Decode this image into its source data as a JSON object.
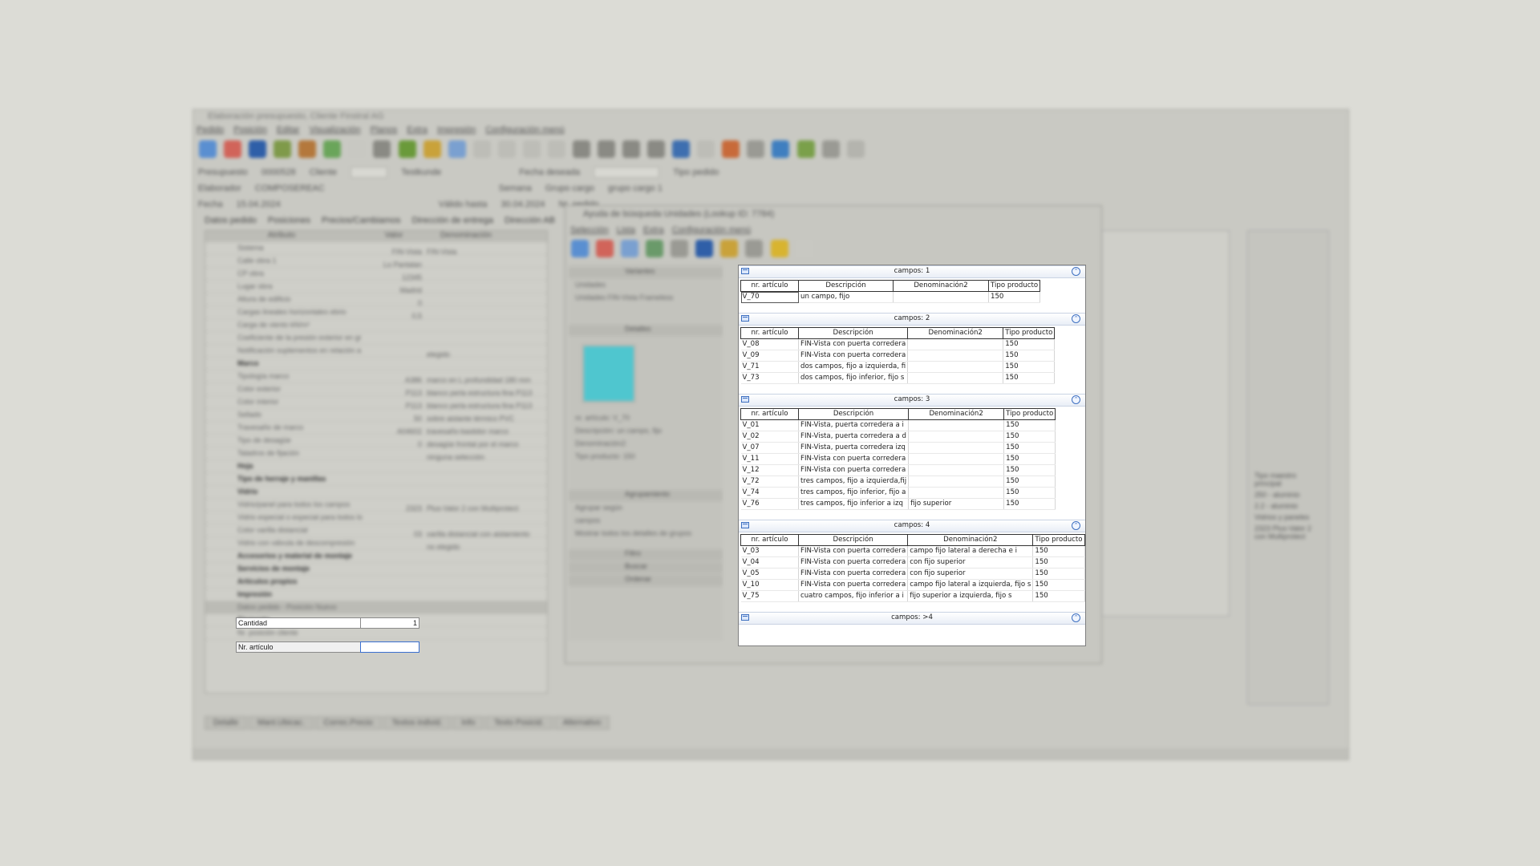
{
  "main_window": {
    "title": "Elaboración presupuesto, Cliente Finstral AG",
    "menu": [
      "Pedido",
      "Posición",
      "Editar",
      "Visualización",
      "Planos",
      "Extra",
      "Impresión",
      "Configuración menú"
    ],
    "form": {
      "presupuesto_label": "Presupuesto",
      "presupuesto_value": "0000528",
      "cliente_label": "Cliente",
      "cliente_value": "Testkunde",
      "fecha_deseada_label": "Fecha deseada",
      "tipo_pedido_label": "Tipo pedido",
      "elaborador_label": "Elaborador",
      "elaborador_value": "COMPOSEREAC",
      "semana_label": "Semana",
      "grupo_cargo_label": "Grupo cargo",
      "grupo_cargo_value": "grupo cargo 1",
      "fecha_label": "Fecha",
      "fecha_value": "15.04.2024",
      "valido_hasta_label": "Válido hasta",
      "valido_hasta_value": "30.04.2024",
      "nr_pedido_label": "Nr. pedido"
    },
    "tabs": [
      "Datos pedido",
      "Posiciones",
      "Precios/Cambiamos",
      "Dirección de entrega",
      "Dirección AB"
    ],
    "grid_headers": [
      "Atributo",
      "Valor",
      "Denominación"
    ],
    "grid_rows": [
      {
        "label": "Sistema",
        "value": "FIN-Vista",
        "desc": "FIN-Vista",
        "kind": "row"
      },
      {
        "label": "Calle obra 1",
        "value": "Lo Pantalan",
        "desc": "",
        "kind": "row"
      },
      {
        "label": "CP obra",
        "value": "12345",
        "desc": "",
        "kind": "row"
      },
      {
        "label": "Lugar obra",
        "value": "Madrid",
        "desc": "",
        "kind": "row"
      },
      {
        "label": "Altura de edificio",
        "value": "0",
        "desc": "",
        "kind": "row"
      },
      {
        "label": "Cargas lineales horizontales ebrio",
        "value": "0,5",
        "desc": "",
        "kind": "row"
      },
      {
        "label": "Carga de viento kN/m²",
        "value": "",
        "desc": "",
        "kind": "row"
      },
      {
        "label": "Coeficiente de la presión exterior en gr",
        "value": "",
        "desc": "",
        "kind": "row"
      },
      {
        "label": "Notificación suplementos en relación a",
        "value": "",
        "desc": "elegido",
        "kind": "row"
      },
      {
        "label": "Marco",
        "value": "",
        "desc": "",
        "kind": "bold"
      },
      {
        "label": "Tipología marco",
        "value": "A386",
        "desc": "marco en L profundidad 180 mm",
        "kind": "row"
      },
      {
        "label": "Color exterior",
        "value": "P113",
        "desc": "blanco perla estructura fina P113",
        "kind": "row"
      },
      {
        "label": "Color interior",
        "value": "P113",
        "desc": "blanco perla estructura fina P113",
        "kind": "row"
      },
      {
        "label": "Sellado",
        "value": "50",
        "desc": "sobre aislante térmico PVC",
        "kind": "row"
      },
      {
        "label": "Travesaño de marco",
        "value": "A04602",
        "desc": "travesaño-bastidor marco",
        "kind": "row"
      },
      {
        "label": "Tipo de desagüe",
        "value": "0",
        "desc": "desagüe frontal por el marco",
        "kind": "row"
      },
      {
        "label": "Taladros de fijación",
        "value": "",
        "desc": "ninguna selección",
        "kind": "row"
      },
      {
        "label": "Hoja",
        "value": "",
        "desc": "",
        "kind": "bold"
      },
      {
        "label": "Tipo de herraje y manillas",
        "value": "",
        "desc": "",
        "kind": "bold"
      },
      {
        "label": "Vidrio",
        "value": "",
        "desc": "",
        "kind": "bold"
      },
      {
        "label": "Vidrio/panel para todos los campos",
        "value": "2323",
        "desc": "Plus-Valor 2 con Multiprotect",
        "kind": "row"
      },
      {
        "label": "Vidrio especial o especial para todos lo",
        "value": "",
        "desc": "",
        "kind": "row"
      },
      {
        "label": "Color varilla distancial",
        "value": "03",
        "desc": "varilla distancial con aislamiento",
        "kind": "row"
      },
      {
        "label": "Vidrio con válvula de descompresión",
        "value": "",
        "desc": "no elegido",
        "kind": "row"
      },
      {
        "label": "Accesorios y material de montaje",
        "value": "",
        "desc": "",
        "kind": "bold"
      },
      {
        "label": "Servicios de montaje",
        "value": "",
        "desc": "",
        "kind": "bold"
      },
      {
        "label": "Artículos propios",
        "value": "",
        "desc": "",
        "kind": "bold"
      },
      {
        "label": "Impresión",
        "value": "",
        "desc": "",
        "kind": "bold"
      },
      {
        "label": "Datos pedido - Posición Nuevo",
        "value": "",
        "desc": "",
        "kind": "sec"
      },
      {
        "label": "Elemento",
        "value": "",
        "desc": "",
        "kind": "bold"
      },
      {
        "label": "Nr. posición cliente",
        "value": "",
        "desc": "",
        "kind": "row"
      }
    ],
    "cantidad_label": "Cantidad",
    "cantidad_value": "1",
    "nr_articulo_label": "Nr. artículo",
    "nr_articulo_value": "",
    "bottom_buttons": [
      "Detalle",
      "Mant.Ubicac.",
      "Correc.Precio",
      "Textos individ.",
      "Info",
      "Texto Posicid.",
      "Alternativo"
    ],
    "right_tree": [
      "Tipo maestro principal",
      "250 - aluminio",
      "2.2 - aluminio",
      "Vidrios y paneles",
      "2323 Plus-Valor 2 con Multiprotect"
    ]
  },
  "dialog": {
    "title": "Ayuda de búsqueda Unidades (Lookup ID: 7784)",
    "menu": [
      "Selección",
      "Lista",
      "Extra",
      "Configuración menú"
    ],
    "left": {
      "variantes_label": "Variantes",
      "option1": "Unidades",
      "option2": "Unidades FIN-Vista Frameless",
      "detalles_label": "Detalles",
      "detail_lines": [
        "nr. artículo: V_70",
        "Descripción: un campo, fijo",
        "Denominación2:",
        "Tipo producto: 150"
      ],
      "agrupamiento_label": "Agrupamiento",
      "agrupar_label": "Agrupar según",
      "agrupar_value": "campos",
      "mostrar_label": "Mostrar todos los detalles de grupos",
      "filtro_label": "Filtro",
      "buscar_label": "Buscar",
      "ordenar_label": "Ordenar"
    },
    "swatch_color": "#4fc6cf"
  },
  "results": {
    "columns": [
      "nr. artículo",
      "Descripción",
      "Denominación2",
      "Tipo producto"
    ],
    "groups": [
      {
        "title": "campos: 1",
        "rows": [
          [
            "V_70",
            "un campo, fijo",
            "",
            "150"
          ]
        ]
      },
      {
        "title": "campos: 2",
        "rows": [
          [
            "V_08",
            "FIN-Vista con puerta corredera",
            "",
            "150"
          ],
          [
            "V_09",
            "FIN-Vista con puerta corredera",
            "",
            "150"
          ],
          [
            "V_71",
            "dos campos, fijo a izquierda, fi",
            "",
            "150"
          ],
          [
            "V_73",
            "dos campos, fijo inferior, fijo s",
            "",
            "150"
          ]
        ]
      },
      {
        "title": "campos: 3",
        "rows": [
          [
            "V_01",
            "FIN-Vista, puerta corredera a i",
            "",
            "150"
          ],
          [
            "V_02",
            "FIN-Vista, puerta corredera a d",
            "",
            "150"
          ],
          [
            "V_07",
            "FIN-Vista, puerta corredera izq",
            "",
            "150"
          ],
          [
            "V_11",
            "FIN-Vista con puerta corredera",
            "",
            "150"
          ],
          [
            "V_12",
            "FIN-Vista con puerta corredera",
            "",
            "150"
          ],
          [
            "V_72",
            "tres campos, fijo a izquierda,fij",
            "",
            "150"
          ],
          [
            "V_74",
            "tres campos, fijo inferior, fijo a",
            "",
            "150"
          ],
          [
            "V_76",
            "tres campos, fijo inferior a izq",
            "fijo superior",
            "150"
          ]
        ]
      },
      {
        "title": "campos: 4",
        "rows": [
          [
            "V_03",
            "FIN-Vista con puerta corredera",
            "campo fijo lateral a derecha e i",
            "150"
          ],
          [
            "V_04",
            "FIN-Vista con puerta corredera",
            "con fijo superior",
            "150"
          ],
          [
            "V_05",
            "FIN-Vista con puerta corredera",
            "con fijo superior",
            "150"
          ],
          [
            "V_10",
            "FIN-Vista con puerta corredera",
            "campo fijo lateral a izquierda, fijo s",
            "150"
          ],
          [
            "V_75",
            "cuatro campos, fijo inferior a i",
            "fijo superior a izquierda, fijo s",
            "150"
          ]
        ]
      },
      {
        "title": "campos: >4",
        "rows": []
      }
    ],
    "accent_color": "#3d6fc0"
  }
}
